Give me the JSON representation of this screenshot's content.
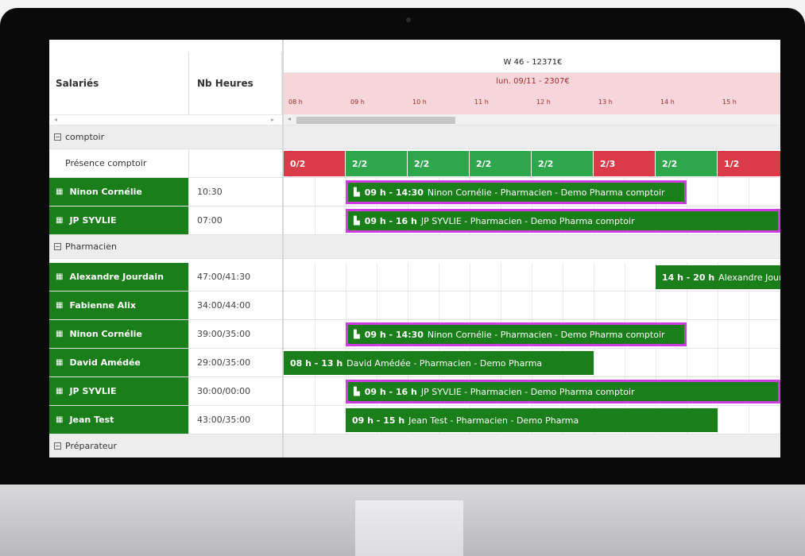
{
  "header": {
    "col_salaries": "Salariés",
    "col_hours": "Nb Heures",
    "week": "W 46 - 12371€",
    "day": "lun. 09/11 - 2307€",
    "hour_ticks": [
      "08 h",
      "09 h",
      "10 h",
      "11 h",
      "12 h",
      "13 h",
      "14 h",
      "15 h"
    ]
  },
  "groups": {
    "comptoir": "comptoir",
    "pharmacien": "Pharmacien",
    "preparateur": "Préparateur"
  },
  "presence": {
    "label": "Présence comptoir",
    "slots": [
      "0/2",
      "2/2",
      "2/2",
      "2/2",
      "2/2",
      "2/3",
      "2/2",
      "1/2"
    ]
  },
  "employees": [
    {
      "name": "Ninon Cornélie",
      "hours": "10:30"
    },
    {
      "name": "JP SYVLIE",
      "hours": "07:00"
    },
    {
      "name": "Alexandre Jourdain",
      "hours": "47:00/41:30"
    },
    {
      "name": "Fabienne Alix",
      "hours": "34:00/44:00"
    },
    {
      "name": "Ninon Cornélie",
      "hours": "39:00/35:00"
    },
    {
      "name": "David Amédée",
      "hours": "29:00/35:00"
    },
    {
      "name": "JP SYVLIE",
      "hours": "30:00/00:00"
    },
    {
      "name": "Jean Test",
      "hours": "43:00/35:00"
    }
  ],
  "shifts": [
    {
      "time": "09 h - 14:30",
      "desc": "Ninon Cornélie - Pharmacien - Demo Pharma comptoir"
    },
    {
      "time": "09 h - 16 h",
      "desc": "JP SYVLIE - Pharmacien - Demo Pharma comptoir"
    },
    {
      "time": "14 h - 20 h",
      "desc": "Alexandre Jourd"
    },
    {
      "time": "09 h - 14:30",
      "desc": "Ninon Cornélie - Pharmacien - Demo Pharma comptoir"
    },
    {
      "time": "08 h - 13 h",
      "desc": "David Amédée - Pharmacien - Demo Pharma"
    },
    {
      "time": "09 h - 16 h",
      "desc": "JP SYVLIE - Pharmacien - Demo Pharma comptoir"
    },
    {
      "time": "09 h - 15 h",
      "desc": "Jean Test - Pharmacien - Demo Pharma"
    }
  ],
  "colors": {
    "employee_green": "#1a7f1a",
    "capacity_red": "#db3b48",
    "capacity_green": "#2ea64b",
    "day_header_pink": "#f6d6da",
    "highlight_magenta": "#d13be6"
  },
  "icons": {
    "employee": "calendar-icon",
    "shift": "building-icon",
    "group_toggle": "collapse-minus-icon"
  }
}
